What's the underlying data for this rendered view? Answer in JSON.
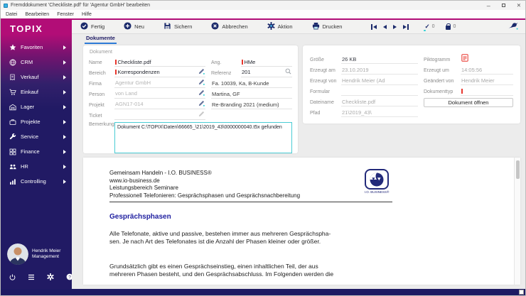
{
  "window": {
    "title": "Fremddokument 'Checkliste.pdf' für 'Agentur GmbH' bearbeiten",
    "controls": {
      "minimize": "–",
      "close": "✕"
    }
  },
  "menubar": {
    "items": [
      "Datei",
      "Bearbeiten",
      "Fenster",
      "Hilfe"
    ]
  },
  "sidebar": {
    "logo": "TOPIX",
    "items": [
      {
        "label": "Favoriten",
        "icon": "star-icon"
      },
      {
        "label": "CRM",
        "icon": "globe-icon"
      },
      {
        "label": "Verkauf",
        "icon": "receipt-icon"
      },
      {
        "label": "Einkauf",
        "icon": "cart-icon"
      },
      {
        "label": "Lager",
        "icon": "warehouse-icon"
      },
      {
        "label": "Projekte",
        "icon": "briefcase-icon"
      },
      {
        "label": "Service",
        "icon": "wrench-icon"
      },
      {
        "label": "Finance",
        "icon": "grid-icon"
      },
      {
        "label": "HR",
        "icon": "people-icon"
      },
      {
        "label": "Controlling",
        "icon": "bar-chart-icon"
      }
    ],
    "user": {
      "name": "Hendrik Meier",
      "role": "Management"
    }
  },
  "toolbar": {
    "fertig": "Fertig",
    "neu": "Neu",
    "sichern": "Sichern",
    "abbrechen": "Abbrechen",
    "aktion": "Aktion",
    "drucken": "Drucken",
    "check_count": "0",
    "lock_count": "0"
  },
  "tab": {
    "label": "Dokumente"
  },
  "form": {
    "group_label": "Dokument",
    "name": {
      "label": "Name",
      "value": "Checkliste.pdf"
    },
    "ang": {
      "label": "Ang.",
      "value": "HMe"
    },
    "bereich": {
      "label": "Bereich",
      "value": "Korrespondenzen"
    },
    "referenz": {
      "label": "Referenz",
      "value": "201"
    },
    "firma": {
      "label": "Firma",
      "value": "Agentur GmbH",
      "info": "Fa. 10039, Ka, B-Kunde"
    },
    "person": {
      "label": "Person",
      "value": "von Land",
      "info": "Martina, GF"
    },
    "projekt": {
      "label": "Projekt",
      "value": "AGN17-014",
      "info": "Re-Branding 2021 (medium)"
    },
    "ticket": {
      "label": "Ticket",
      "value": ""
    },
    "bemerkung": {
      "label": "Bemerkung",
      "value": "Dokument C:\\TOPIX\\Daten\\66665_\\21\\2019_43\\0000000040.t5x gefunden"
    }
  },
  "details": {
    "groesse": {
      "label": "Größe",
      "value": "26 KB"
    },
    "erzeugt_am": {
      "label": "Erzeugt am",
      "value": "23.10.2019"
    },
    "erzeugt_von": {
      "label": "Erzeugt von",
      "value": "Hendrik Meier (Ad"
    },
    "formular": {
      "label": "Formular",
      "value": ""
    },
    "dateiname": {
      "label": "Dateiname",
      "value": "Checkliste.pdf"
    },
    "pfad": {
      "label": "Pfad",
      "value": "21\\2019_43\\"
    },
    "piktogramm": {
      "label": "Piktogramm",
      "icon": "pdf-file-icon"
    },
    "erzeugt_um": {
      "label": "Erzeugt um",
      "value": "14:05:56"
    },
    "geaendert_von": {
      "label": "Geändert von",
      "value": "Hendrik Meier"
    },
    "dokumenttyp": {
      "label": "Dokumenttyp"
    },
    "open_button": "Dokument öffnen"
  },
  "preview": {
    "header_lines": [
      "Gemeinsam Handeln - I.O. BUSINESS®",
      "www.io-business.de",
      "Leistungsbereich Seminare",
      "Professionell Telefonieren: Gesprächsphasen und Gesprächsnachbereitung"
    ],
    "logo_caption": "I.O. BUSINESS®",
    "heading": "Gesprächsphasen",
    "paragraph1": "Alle Telefonate, aktive und passive, bestehen immer aus mehreren Gesprächspha-\nsen. Je nach Art des Telefonates ist die Anzahl der Phasen kleiner oder größer.",
    "paragraph2": "Grundsätzlich gibt es einen Gesprächseinstieg, einen inhaltlichen Teil, der aus\nmehreren Phasen besteht, und den Gesprächsabschluss. Im Folgenden werden die"
  },
  "colors": {
    "brand_magenta": "#b20d77",
    "navy": "#211a64",
    "toolbar_icon_navy": "#1b2a6b",
    "teal_accent": "#2ecfd4",
    "required_red": "#e8372e",
    "tab_underline_blue": "#2e7bd6",
    "remark_border_cyan": "#49ccd4"
  }
}
